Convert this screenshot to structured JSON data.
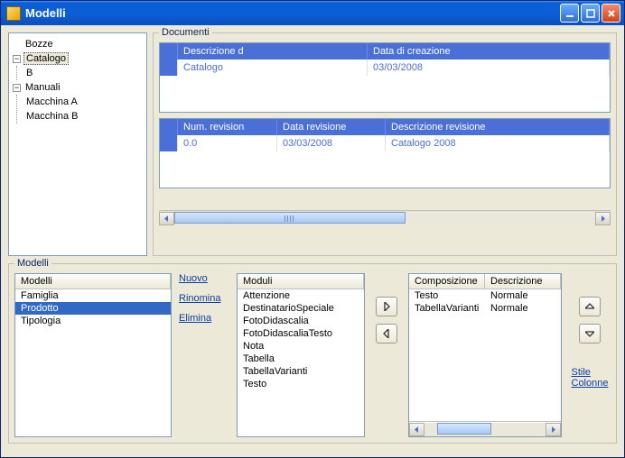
{
  "window": {
    "title": "Modelli"
  },
  "tree": {
    "bozze": "Bozze",
    "catalogo": "Catalogo",
    "catalogo_children": [
      "B"
    ],
    "manuali": "Manuali",
    "manuali_children": [
      "Macchina A",
      "Macchina B"
    ]
  },
  "documenti": {
    "label": "Documenti",
    "grid1": {
      "cols": [
        "Descrizione d",
        "Data di creazione"
      ],
      "row": {
        "descr": "Catalogo",
        "data": "03/03/2008"
      }
    },
    "grid2": {
      "cols": [
        "Num. revision",
        "Data revisione",
        "Descrizione revisione"
      ],
      "row": {
        "num": "0.0",
        "data": "03/03/2008",
        "descr": "Catalogo 2008"
      }
    }
  },
  "modelli": {
    "label": "Modelli",
    "list": {
      "header": "Modelli",
      "items": [
        "Famiglia",
        "Prodotto",
        "Tipologia"
      ],
      "selected": "Prodotto"
    },
    "links": {
      "nuovo": "Nuovo",
      "rinomina": "Rinomina",
      "elimina": "Elimina"
    },
    "moduli": {
      "header": "Moduli",
      "items": [
        "Attenzione",
        "DestinatarioSpeciale",
        "FotoDidascalia",
        "FotoDidascaliaTesto",
        "Nota",
        "Tabella",
        "TabellaVarianti",
        "Testo"
      ]
    },
    "composizione": {
      "headers": [
        "Composizione",
        "Descrizione"
      ],
      "rows": [
        {
          "comp": "Testo",
          "descr": "Normale"
        },
        {
          "comp": "TabellaVarianti",
          "descr": "Normale"
        }
      ]
    },
    "right_links": {
      "stile": "Stile",
      "colonne": "Colonne"
    }
  }
}
